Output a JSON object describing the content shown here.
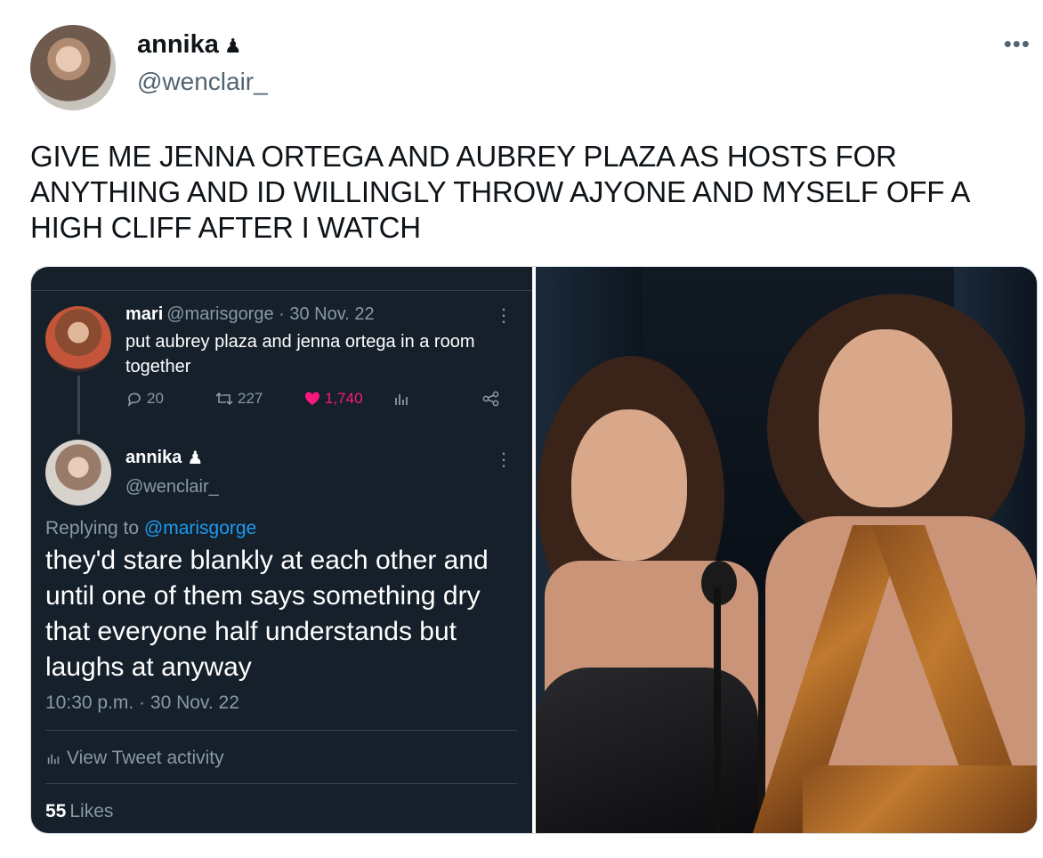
{
  "author": {
    "name": "annika",
    "badge_icon": "chess-pawn-icon",
    "handle": "@wenclair_"
  },
  "more_label": "•••",
  "tweet_text": "GIVE ME JENNA ORTEGA AND AUBREY PLAZA AS HOSTS FOR ANYTHING AND ID WILLINGLY THROW AJYONE AND MYSELF OFF A HIGH CLIFF AFTER I WATCH",
  "embedded": {
    "original": {
      "name": "mari",
      "meta": "@marisgorge · 30 Nov. 22",
      "text": "put aubrey plaza and jenna ortega in a room together",
      "replies": "20",
      "retweets": "227",
      "likes": "1,740"
    },
    "reply": {
      "name": "annika",
      "handle": "@wenclair_",
      "replying_prefix": "Replying to",
      "replying_to": "@marisgorge",
      "text": "they'd stare blankly at each other and until one of them says something dry that everyone half understands but laughs at anyway",
      "time": "10:30 p.m. · 30 Nov. 22",
      "activity_label": "View Tweet activity",
      "likes_count": "55",
      "likes_label": "Likes"
    },
    "kebab": "⋮"
  },
  "colors": {
    "dark_bg": "#15202b",
    "accent": "#1d9bf0",
    "like": "#f91880",
    "muted": "#8899a6"
  }
}
